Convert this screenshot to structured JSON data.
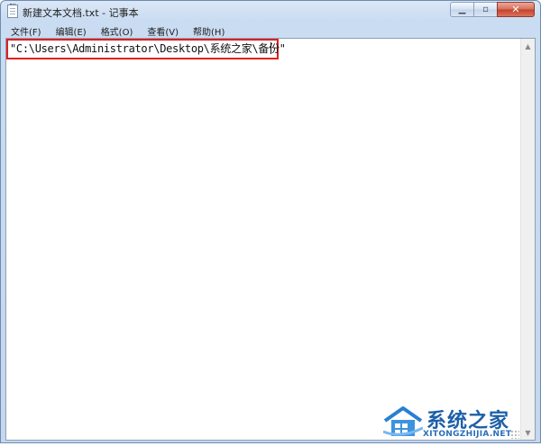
{
  "window": {
    "title": "新建文本文档.txt - 记事本",
    "controls": {
      "minimize_icon": "minimize-icon",
      "maximize_icon": "maximize-icon",
      "close_icon": "close-icon"
    }
  },
  "menu": {
    "items": [
      {
        "label": "文件(F)"
      },
      {
        "label": "编辑(E)"
      },
      {
        "label": "格式(O)"
      },
      {
        "label": "查看(V)"
      },
      {
        "label": "帮助(H)"
      }
    ]
  },
  "editor": {
    "text": "\"C:\\Users\\Administrator\\Desktop\\系统之家\\备份\"",
    "highlight_color": "#e11e1e"
  },
  "watermark": {
    "brand": "系统之家",
    "domain": "XITONGZHIJIA.NET",
    "brand_color": "#1c5fa8"
  }
}
